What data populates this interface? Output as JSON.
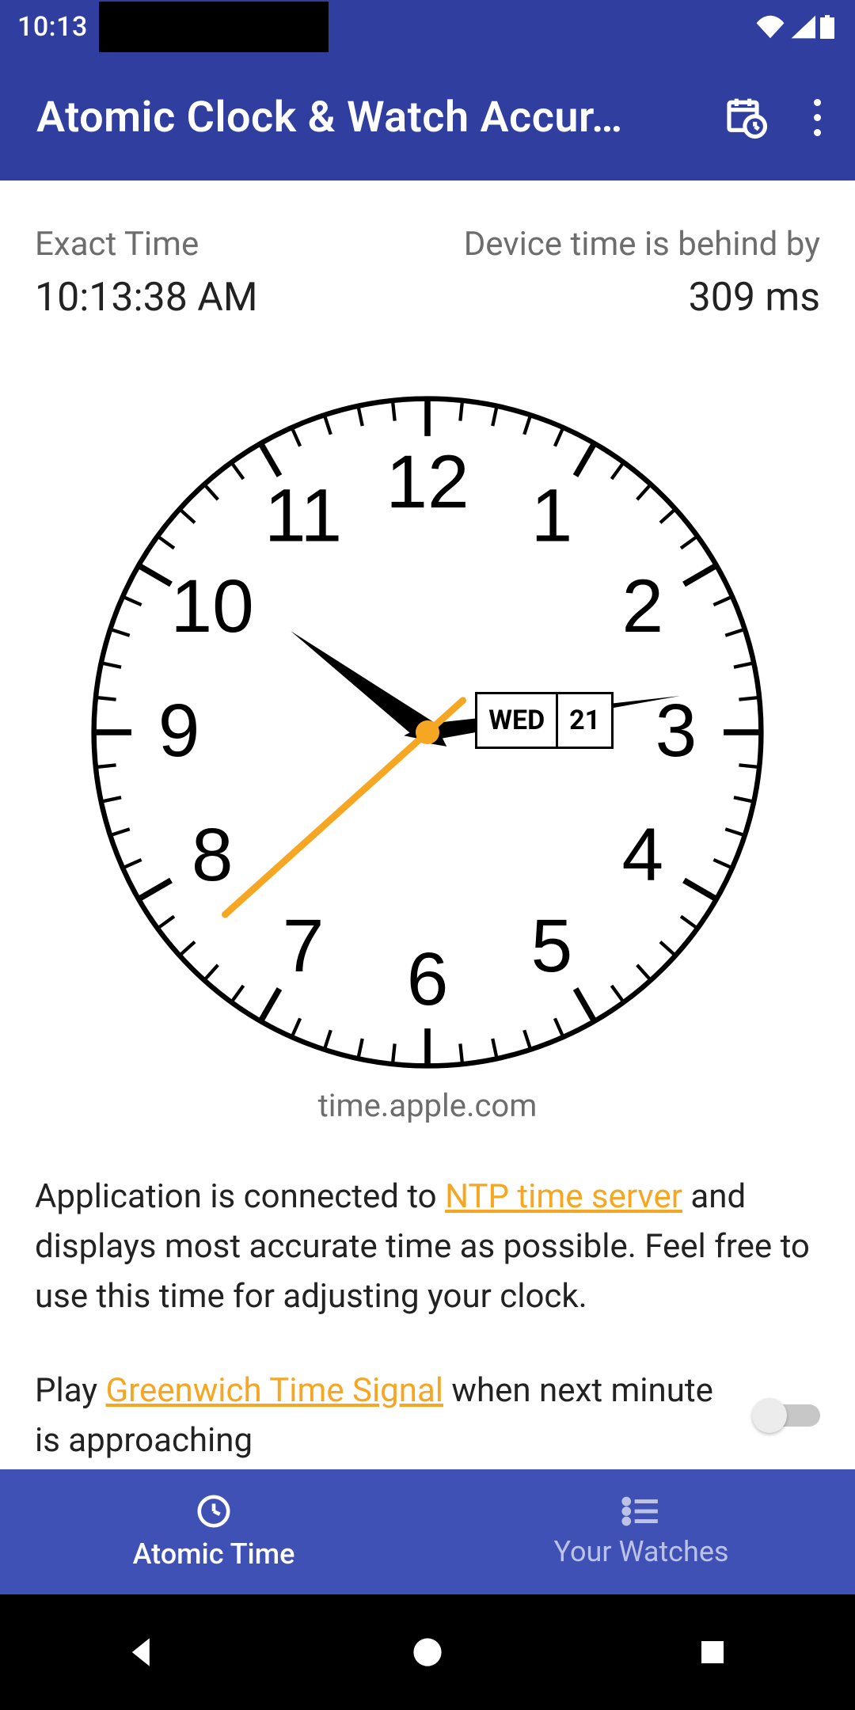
{
  "statusbar": {
    "time": "10:13"
  },
  "appbar": {
    "title": "Atomic Clock & Watch Accur…"
  },
  "main": {
    "exact_label": "Exact Time",
    "exact_value": "10:13:38 AM",
    "offset_label": "Device time is behind by",
    "offset_value": "309 ms",
    "server": "time.apple.com",
    "hours": [
      "12",
      "1",
      "2",
      "3",
      "4",
      "5",
      "6",
      "7",
      "8",
      "9",
      "10",
      "11"
    ],
    "date": {
      "weekday": "WED",
      "day": "21"
    },
    "time": {
      "h": 10,
      "m": 13,
      "s": 38
    },
    "desc1_a": "Application is connected to ",
    "desc1_link": "NTP time server",
    "desc1_b": " and displays most accurate time as possible. Feel free to use this time for adjusting your clock.",
    "desc2_a": "Play ",
    "desc2_link": "Greenwich Time Signal",
    "desc2_b": " when next minute is approaching",
    "signal_toggle": false
  },
  "bottomnav": {
    "atomic": "Atomic Time",
    "watches": "Your Watches"
  }
}
